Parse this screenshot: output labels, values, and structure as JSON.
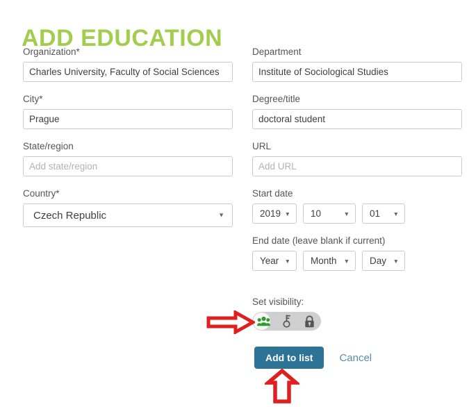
{
  "page": {
    "title": "ADD EDUCATION"
  },
  "form": {
    "left": [
      {
        "key": "organization",
        "label": "Organization*",
        "value": "Charles University, Faculty of Social Sciences",
        "placeholder": ""
      },
      {
        "key": "city",
        "label": "City*",
        "value": "Prague",
        "placeholder": ""
      },
      {
        "key": "state_region",
        "label": "State/region",
        "value": "",
        "placeholder": "Add state/region"
      }
    ],
    "country": {
      "label": "Country*",
      "value": "Czech Republic"
    },
    "right": [
      {
        "key": "department",
        "label": "Department",
        "value": "Institute of Sociological Studies",
        "placeholder": ""
      },
      {
        "key": "degree_title",
        "label": "Degree/title",
        "value": "doctoral student",
        "placeholder": ""
      },
      {
        "key": "url",
        "label": "URL",
        "value": "",
        "placeholder": "Add URL"
      }
    ],
    "start_date": {
      "label": "Start date",
      "year": "2019",
      "month": "10",
      "day": "01"
    },
    "end_date": {
      "label": "End date (leave blank if current)",
      "year": "Year",
      "month": "Month",
      "day": "Day"
    },
    "visibility": {
      "label": "Set visibility:",
      "selected": "public",
      "options": [
        {
          "key": "public",
          "icon": "people-icon",
          "selected": true
        },
        {
          "key": "restricted",
          "icon": "key-icon",
          "selected": false
        },
        {
          "key": "private",
          "icon": "lock-icon",
          "selected": false
        }
      ]
    },
    "actions": {
      "submit_label": "Add to list",
      "cancel_label": "Cancel"
    }
  },
  "annotations": {
    "arrow_right": "arrow-right-icon",
    "arrow_up": "arrow-up-icon"
  },
  "colors": {
    "heading": "#a3cd4e",
    "primary_button": "#2d7395",
    "cancel_link": "#5a8ea8",
    "visibility_selected": "#2f9b2f",
    "annotation": "#e01f1f"
  }
}
